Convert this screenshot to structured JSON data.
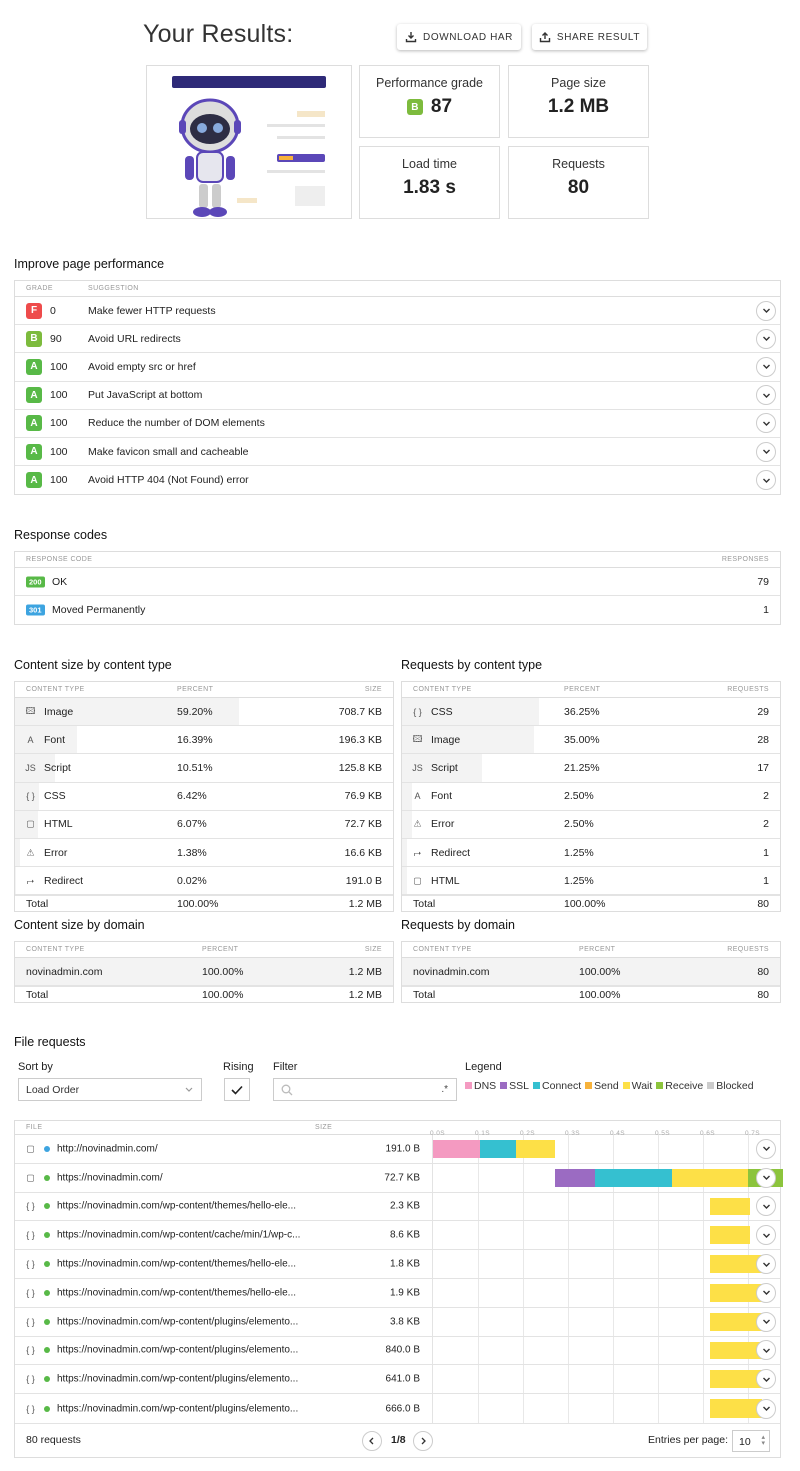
{
  "header": {
    "title": "Your Results:",
    "download_label": "DOWNLOAD HAR",
    "share_label": "SHARE RESULT"
  },
  "summary": {
    "perf_label": "Performance grade",
    "perf_grade": "B",
    "perf_value": "87",
    "size_label": "Page size",
    "size_value": "1.2 MB",
    "load_label": "Load time",
    "load_value": "1.83 s",
    "req_label": "Requests",
    "req_value": "80"
  },
  "improve": {
    "title": "Improve page performance",
    "col_grade": "GRADE",
    "col_suggestion": "SUGGESTION",
    "rows": [
      {
        "grade": "F",
        "score": "0",
        "text": "Make fewer HTTP requests"
      },
      {
        "grade": "B",
        "score": "90",
        "text": "Avoid URL redirects"
      },
      {
        "grade": "A",
        "score": "100",
        "text": "Avoid empty src or href"
      },
      {
        "grade": "A",
        "score": "100",
        "text": "Put JavaScript at bottom"
      },
      {
        "grade": "A",
        "score": "100",
        "text": "Reduce the number of DOM elements"
      },
      {
        "grade": "A",
        "score": "100",
        "text": "Make favicon small and cacheable"
      },
      {
        "grade": "A",
        "score": "100",
        "text": "Avoid HTTP 404 (Not Found) error"
      }
    ]
  },
  "responses": {
    "title": "Response codes",
    "col_code": "RESPONSE CODE",
    "col_resp": "RESPONSES",
    "rows": [
      {
        "code": "200",
        "label": "OK",
        "count": "79"
      },
      {
        "code": "301",
        "label": "Moved Permanently",
        "count": "1"
      }
    ]
  },
  "size_by_type": {
    "title": "Content size by content type",
    "col1": "CONTENT TYPE",
    "col2": "PERCENT",
    "col3": "SIZE",
    "rows": [
      {
        "icon": "🖾",
        "type": "Image",
        "percent": "59.20%",
        "value": "708.7 KB",
        "fraction": 0.592
      },
      {
        "icon": "A",
        "type": "Font",
        "percent": "16.39%",
        "value": "196.3 KB",
        "fraction": 0.1639
      },
      {
        "icon": "JS",
        "type": "Script",
        "percent": "10.51%",
        "value": "125.8 KB",
        "fraction": 0.1051
      },
      {
        "icon": "{ }",
        "type": "CSS",
        "percent": "6.42%",
        "value": "76.9 KB",
        "fraction": 0.0642
      },
      {
        "icon": "▢",
        "type": "HTML",
        "percent": "6.07%",
        "value": "72.7 KB",
        "fraction": 0.0607
      },
      {
        "icon": "⚠",
        "type": "Error",
        "percent": "1.38%",
        "value": "16.6 KB",
        "fraction": 0.0138
      },
      {
        "icon": "⮣",
        "type": "Redirect",
        "percent": "0.02%",
        "value": "191.0 B",
        "fraction": 0.0002
      }
    ],
    "total": {
      "label": "Total",
      "percent": "100.00%",
      "value": "1.2 MB"
    }
  },
  "req_by_type": {
    "title": "Requests by content type",
    "col1": "CONTENT TYPE",
    "col2": "PERCENT",
    "col3": "REQUESTS",
    "rows": [
      {
        "icon": "{ }",
        "type": "CSS",
        "percent": "36.25%",
        "value": "29",
        "fraction": 0.3625
      },
      {
        "icon": "🖾",
        "type": "Image",
        "percent": "35.00%",
        "value": "28",
        "fraction": 0.35
      },
      {
        "icon": "JS",
        "type": "Script",
        "percent": "21.25%",
        "value": "17",
        "fraction": 0.2125
      },
      {
        "icon": "A",
        "type": "Font",
        "percent": "2.50%",
        "value": "2",
        "fraction": 0.025
      },
      {
        "icon": "⚠",
        "type": "Error",
        "percent": "2.50%",
        "value": "2",
        "fraction": 0.025
      },
      {
        "icon": "⮣",
        "type": "Redirect",
        "percent": "1.25%",
        "value": "1",
        "fraction": 0.0125
      },
      {
        "icon": "▢",
        "type": "HTML",
        "percent": "1.25%",
        "value": "1",
        "fraction": 0.0125
      }
    ],
    "total": {
      "label": "Total",
      "percent": "100.00%",
      "value": "80"
    }
  },
  "size_by_domain": {
    "title": "Content size by domain",
    "col1": "CONTENT TYPE",
    "col2": "PERCENT",
    "col3": "SIZE",
    "rows": [
      {
        "domain": "novinadmin.com",
        "percent": "100.00%",
        "value": "1.2 MB"
      }
    ],
    "total": {
      "label": "Total",
      "percent": "100.00%",
      "value": "1.2 MB"
    }
  },
  "req_by_domain": {
    "title": "Requests by domain",
    "col1": "CONTENT TYPE",
    "col2": "PERCENT",
    "col3": "REQUESTS",
    "rows": [
      {
        "domain": "novinadmin.com",
        "percent": "100.00%",
        "value": "80"
      }
    ],
    "total": {
      "label": "Total",
      "percent": "100.00%",
      "value": "80"
    }
  },
  "files": {
    "title": "File requests",
    "sort_label": "Sort by",
    "sort_value": "Load Order",
    "rising_label": "Rising",
    "filter_label": "Filter",
    "filter_regex": ".*",
    "legend_label": "Legend",
    "legend": [
      {
        "name": "DNS",
        "color": "#f49ac1"
      },
      {
        "name": "SSL",
        "color": "#9b6bc2"
      },
      {
        "name": "Connect",
        "color": "#35c0d0"
      },
      {
        "name": "Send",
        "color": "#f7b23b"
      },
      {
        "name": "Wait",
        "color": "#fde047"
      },
      {
        "name": "Receive",
        "color": "#8cc43c"
      },
      {
        "name": "Blocked",
        "color": "#cccccc"
      }
    ],
    "col_file": "FILE",
    "col_size": "SIZE",
    "ticks": [
      "0.0s",
      "0.1s",
      "0.2s",
      "0.3s",
      "0.4s",
      "0.5s",
      "0.6s",
      "0.7s"
    ],
    "rows": [
      {
        "icon": "▢",
        "dot": "#3da4e0",
        "url": "http://novinadmin.com/",
        "size": "191.0 B",
        "segs": [
          {
            "t": "dns",
            "s": 0.0,
            "e": 0.105
          },
          {
            "t": "connect",
            "s": 0.105,
            "e": 0.185
          },
          {
            "t": "wait",
            "s": 0.185,
            "e": 0.27
          }
        ]
      },
      {
        "icon": "▢",
        "dot": "#58b947",
        "url": "https://novinadmin.com/",
        "size": "72.7 KB",
        "segs": [
          {
            "t": "ssl",
            "s": 0.27,
            "e": 0.36
          },
          {
            "t": "connect",
            "s": 0.36,
            "e": 0.53
          },
          {
            "t": "wait",
            "s": 0.53,
            "e": 0.7
          },
          {
            "t": "receive",
            "s": 0.7,
            "e": 0.8
          }
        ]
      },
      {
        "icon": "{ }",
        "dot": "#58b947",
        "url": "https://novinadmin.com/wp-content/themes/hello-ele...",
        "size": "2.3 KB",
        "segs": [
          {
            "t": "wait",
            "s": 0.615,
            "e": 0.705
          }
        ]
      },
      {
        "icon": "{ }",
        "dot": "#58b947",
        "url": "https://novinadmin.com/wp-content/cache/min/1/wp-c...",
        "size": "8.6 KB",
        "segs": [
          {
            "t": "wait",
            "s": 0.615,
            "e": 0.705
          }
        ]
      },
      {
        "icon": "{ }",
        "dot": "#58b947",
        "url": "https://novinadmin.com/wp-content/themes/hello-ele...",
        "size": "1.8 KB",
        "segs": [
          {
            "t": "wait",
            "s": 0.615,
            "e": 0.73
          }
        ]
      },
      {
        "icon": "{ }",
        "dot": "#58b947",
        "url": "https://novinadmin.com/wp-content/themes/hello-ele...",
        "size": "1.9 KB",
        "segs": [
          {
            "t": "wait",
            "s": 0.615,
            "e": 0.73
          }
        ]
      },
      {
        "icon": "{ }",
        "dot": "#58b947",
        "url": "https://novinadmin.com/wp-content/plugins/elemento...",
        "size": "3.8 KB",
        "segs": [
          {
            "t": "wait",
            "s": 0.615,
            "e": 0.73
          }
        ]
      },
      {
        "icon": "{ }",
        "dot": "#58b947",
        "url": "https://novinadmin.com/wp-content/plugins/elemento...",
        "size": "840.0 B",
        "segs": [
          {
            "t": "wait",
            "s": 0.615,
            "e": 0.73
          }
        ]
      },
      {
        "icon": "{ }",
        "dot": "#58b947",
        "url": "https://novinadmin.com/wp-content/plugins/elemento...",
        "size": "641.0 B",
        "segs": [
          {
            "t": "wait",
            "s": 0.615,
            "e": 0.73
          }
        ]
      },
      {
        "icon": "{ }",
        "dot": "#58b947",
        "url": "https://novinadmin.com/wp-content/plugins/elemento...",
        "size": "666.0 B",
        "segs": [
          {
            "t": "wait",
            "s": 0.615,
            "e": 0.73
          }
        ]
      }
    ],
    "count_label": "80 requests",
    "page": "1/8",
    "per_page_label": "Entries per page:",
    "per_page": "10"
  }
}
